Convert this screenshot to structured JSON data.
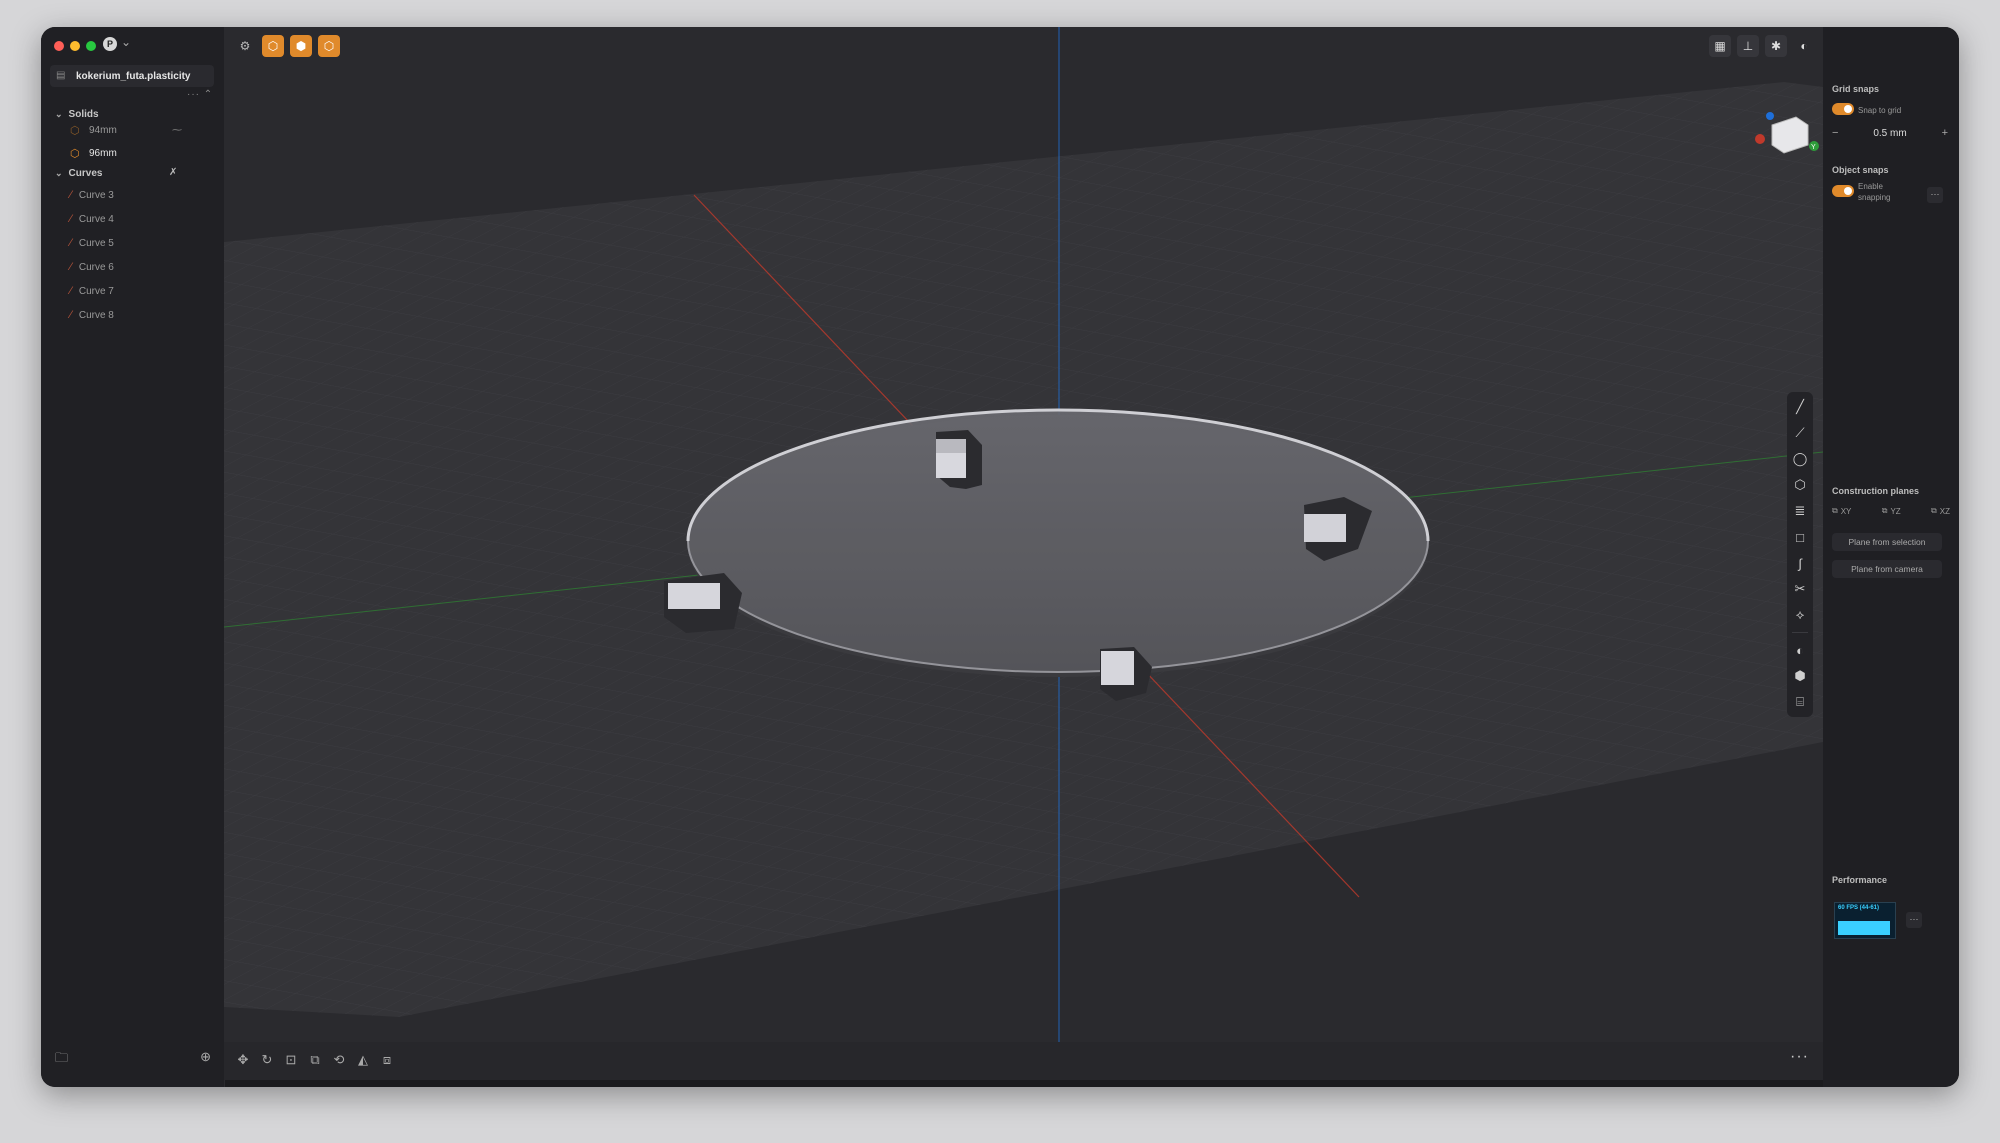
{
  "app": {
    "file_name": "kokerium_futa.plasticity",
    "project_initial": "P"
  },
  "tree": {
    "solids": {
      "label": "Solids",
      "items": [
        {
          "label": "94mm"
        },
        {
          "label": "96mm"
        }
      ]
    },
    "curves": {
      "label": "Curves",
      "items": [
        {
          "label": "Curve 3"
        },
        {
          "label": "Curve 4"
        },
        {
          "label": "Curve 5"
        },
        {
          "label": "Curve 6"
        },
        {
          "label": "Curve 7"
        },
        {
          "label": "Curve 8"
        }
      ]
    },
    "more": "···"
  },
  "viewport": {
    "more": "···",
    "gizmo_y_label": "Y"
  },
  "right_panel": {
    "grid_snaps": {
      "title": "Grid snaps",
      "toggle_label": "Snap to grid",
      "value": "0.5 mm",
      "minus": "−",
      "plus": "+"
    },
    "object_snaps": {
      "title": "Object snaps",
      "toggle_label_1": "Enable",
      "toggle_label_2": "snapping",
      "more": "···"
    },
    "construction_planes": {
      "title": "Construction planes",
      "planes": [
        "XY",
        "YZ",
        "XZ"
      ],
      "from_selection": "Plane from selection",
      "from_camera": "Plane from camera"
    },
    "performance": {
      "title": "Performance",
      "fps_label": "60 FPS (44-61)",
      "more": "···"
    }
  },
  "colors": {
    "accent": "#e08a2b",
    "x_axis": "#c0392b",
    "y_axis": "#2e7d32",
    "z_axis": "#1e6fd9"
  }
}
